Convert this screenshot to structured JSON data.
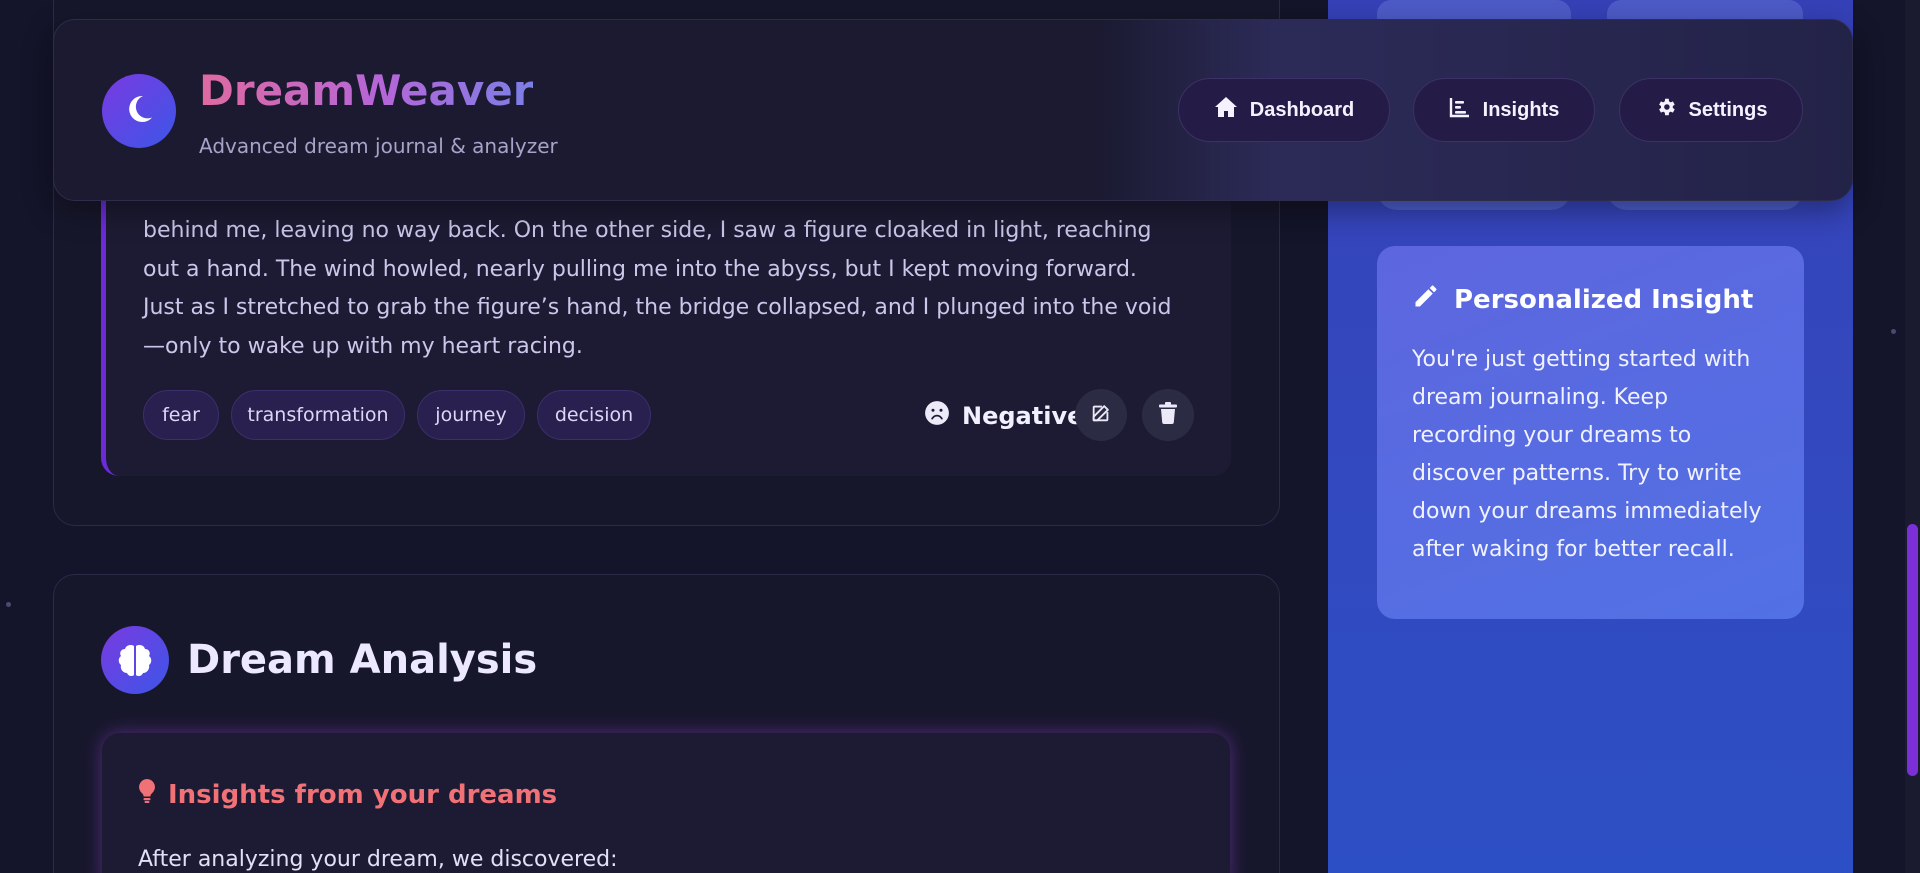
{
  "header": {
    "app_title": "DreamWeaver",
    "app_subtitle": "Advanced dream journal & analyzer",
    "logo_icon": "moon-icon",
    "nav": [
      {
        "label": "Dashboard",
        "icon": "home-icon"
      },
      {
        "label": "Insights",
        "icon": "chart-icon"
      },
      {
        "label": "Settings",
        "icon": "gear-icon"
      }
    ]
  },
  "dream_entry": {
    "text": "behind me, leaving no way back. On the other side, I saw a figure cloaked in light, reaching out a hand. The wind howled, nearly pulling me into the abyss, but I kept moving forward. Just as I stretched to grab the figure’s hand, the bridge collapsed, and I plunged into the void—only to wake up with my heart racing.",
    "tags": [
      "fear",
      "transformation",
      "journey",
      "decision"
    ],
    "mood": {
      "label": "Negative",
      "icon": "frown-icon"
    },
    "actions": [
      {
        "name": "edit",
        "icon": "edit-icon"
      },
      {
        "name": "delete",
        "icon": "trash-icon"
      }
    ]
  },
  "analysis": {
    "title": "Dream Analysis",
    "icon": "brain-icon",
    "insights_heading": "Insights from your dreams",
    "insights_icon": "lightbulb-icon",
    "intro": "After analyzing your dream, we discovered:"
  },
  "sidebar": {
    "personalized_insight": {
      "title": "Personalized Insight",
      "icon": "pencil-icon",
      "text": "You're just getting started with dream journaling. Keep recording your dreams to discover patterns. Try to write down your dreams immediately after waking for better recall."
    }
  },
  "colors": {
    "background": "#14142a",
    "accent_purple": "#6b2bd9",
    "sidebar_blue": "#3447bd",
    "insight_red": "#f07176"
  }
}
